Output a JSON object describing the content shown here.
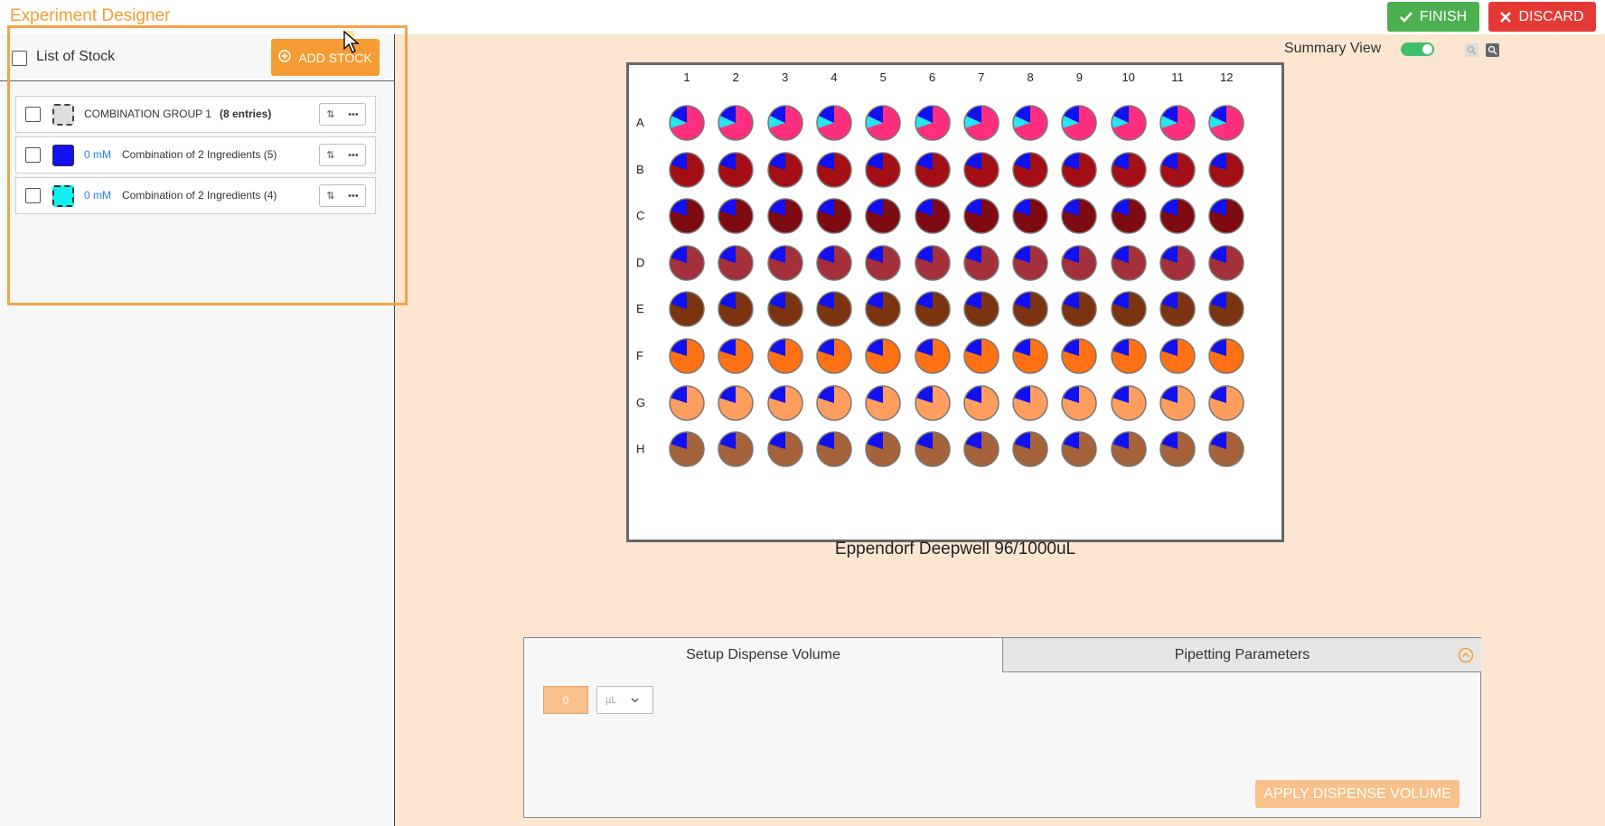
{
  "app": {
    "title": "Experiment Designer"
  },
  "toolbar": {
    "finish_label": "FINISH",
    "discard_label": "DISCARD"
  },
  "stock_panel": {
    "header_label": "List of Stock",
    "add_stock_label": "ADD STOCK",
    "rows": [
      {
        "name": "COMBINATION GROUP 1",
        "entries": "(8 entries)",
        "conc": "",
        "swatch": "group"
      },
      {
        "name": "Combination of 2 Ingredients (5)",
        "entries": "",
        "conc": "0 mM",
        "swatch": "blue",
        "color": "#1010f0"
      },
      {
        "name": "Combination of 2 Ingredients (4)",
        "entries": "",
        "conc": "0 mM",
        "swatch": "cyan",
        "color": "#10f0f0"
      }
    ]
  },
  "summary_view": {
    "label": "Summary View",
    "enabled": true
  },
  "plate": {
    "name": "Eppendorf Deepwell 96/1000uL",
    "columns": [
      "1",
      "2",
      "3",
      "4",
      "5",
      "6",
      "7",
      "8",
      "9",
      "10",
      "11",
      "12"
    ],
    "rows": [
      {
        "letter": "A",
        "base_color": "#ff2e7e",
        "blue_fraction": 0.18,
        "cyan_fraction": 0.12
      },
      {
        "letter": "B",
        "base_color": "#a30f14",
        "blue_fraction": 0.2,
        "cyan_fraction": 0
      },
      {
        "letter": "C",
        "base_color": "#7e0a12",
        "blue_fraction": 0.2,
        "cyan_fraction": 0
      },
      {
        "letter": "D",
        "base_color": "#a3303a",
        "blue_fraction": 0.2,
        "cyan_fraction": 0
      },
      {
        "letter": "E",
        "base_color": "#7c3410",
        "blue_fraction": 0.2,
        "cyan_fraction": 0
      },
      {
        "letter": "F",
        "base_color": "#ff7112",
        "blue_fraction": 0.2,
        "cyan_fraction": 0
      },
      {
        "letter": "G",
        "base_color": "#ff9e5e",
        "blue_fraction": 0.2,
        "cyan_fraction": 0
      },
      {
        "letter": "H",
        "base_color": "#a6623a",
        "blue_fraction": 0.2,
        "cyan_fraction": 0
      }
    ],
    "blue_color": "#1010f0",
    "cyan_color": "#22e6f0"
  },
  "dispense": {
    "tabs": [
      "Setup Dispense Volume",
      "Pipetting Parameters"
    ],
    "volume_value": "0",
    "unit": "µL",
    "apply_label": "APPLY DISPENSE VOLUME"
  }
}
